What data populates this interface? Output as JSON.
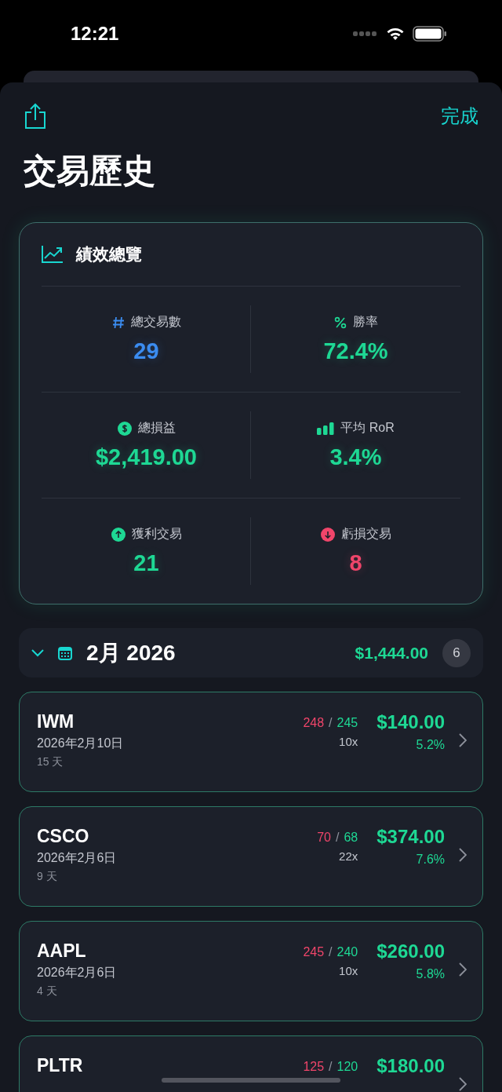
{
  "status_bar": {
    "time": "12:21"
  },
  "nav": {
    "done": "完成"
  },
  "title": "交易歷史",
  "summary": {
    "title": "績效總覽",
    "stats": [
      {
        "kind": "hash",
        "label": "總交易數",
        "value": "29",
        "color": "#3b8cf0"
      },
      {
        "kind": "percent",
        "label": "勝率",
        "value": "72.4%",
        "color": "#1ed894"
      },
      {
        "kind": "dollar",
        "label": "總損益",
        "value": "$2,419.00",
        "color": "#1ed894"
      },
      {
        "kind": "bars",
        "label": "平均 RoR",
        "value": "3.4%",
        "color": "#1ed894"
      },
      {
        "kind": "up",
        "label": "獲利交易",
        "value": "21",
        "color": "#1ed894"
      },
      {
        "kind": "down",
        "label": "虧損交易",
        "value": "8",
        "color": "#f0456a"
      }
    ]
  },
  "month": {
    "expanded": true,
    "title": "2月 2026",
    "total": "$1,444.00",
    "count": "6"
  },
  "trades": [
    {
      "ticker": "IWM",
      "date": "2026年2月10日",
      "days": "15 天",
      "entry": "248",
      "separator": "/",
      "exit": "245",
      "leverage": "10x",
      "pnl": "$140.00",
      "ror": "5.2%"
    },
    {
      "ticker": "CSCO",
      "date": "2026年2月6日",
      "days": "9 天",
      "entry": "70",
      "separator": "/",
      "exit": "68",
      "leverage": "22x",
      "pnl": "$374.00",
      "ror": "7.6%"
    },
    {
      "ticker": "AAPL",
      "date": "2026年2月6日",
      "days": "4 天",
      "entry": "245",
      "separator": "/",
      "exit": "240",
      "leverage": "10x",
      "pnl": "$260.00",
      "ror": "5.8%"
    },
    {
      "ticker": "PLTR",
      "entry": "125",
      "separator": "/",
      "exit": "120",
      "pnl": "$180.00"
    }
  ]
}
